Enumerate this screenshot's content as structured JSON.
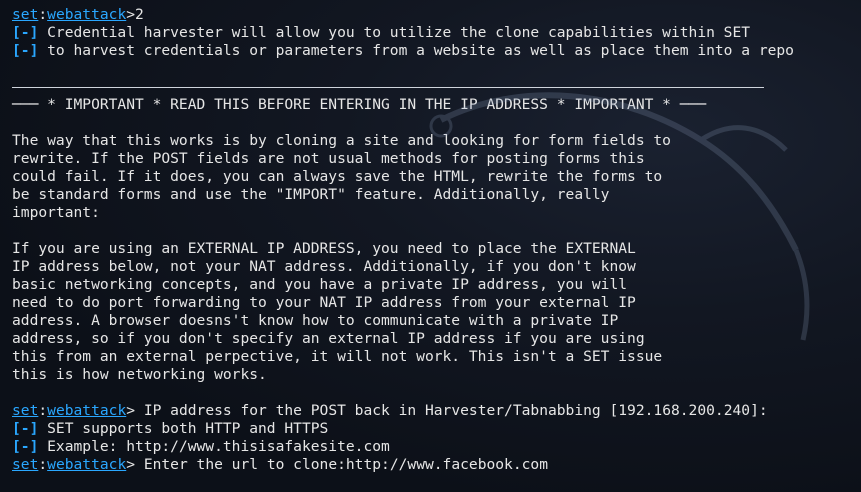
{
  "prompt": {
    "set": "set",
    "sep": ":",
    "module": "webattack",
    "gt": ">"
  },
  "lines": {
    "l1_input": "2",
    "info_tag": "[-]",
    "l2": " Credential harvester will allow you to utilize the clone capabilities within SET",
    "l3": " to harvest credentials or parameters from a website as well as place them into a repo",
    "banner": "─── * IMPORTANT * READ THIS BEFORE ENTERING IN THE IP ADDRESS * IMPORTANT * ───",
    "p1": [
      "The way that this works is by cloning a site and looking for form fields to",
      "rewrite. If the POST fields are not usual methods for posting forms this",
      "could fail. If it does, you can always save the HTML, rewrite the forms to",
      "be standard forms and use the \"IMPORT\" feature. Additionally, really",
      "important:"
    ],
    "p2": [
      "If you are using an EXTERNAL IP ADDRESS, you need to place the EXTERNAL",
      "IP address below, not your NAT address. Additionally, if you don't know",
      "basic networking concepts, and you have a private IP address, you will",
      "need to do port forwarding to your NAT IP address from your external IP",
      "address. A browser doesns't know how to communicate with a private IP",
      "address, so if you don't specify an external IP address if you are using",
      "this from an external perpective, it will not work. This isn't a SET issue",
      "this is how networking works."
    ],
    "ip_prompt": " IP address for the POST back in Harvester/Tabnabbing [192.168.200.240]:",
    "supports": " SET supports both HTTP and HTTPS",
    "example": " Example: http://www.thisisafakesite.com",
    "url_prompt": " Enter the url to clone:http://www.facebook.com"
  },
  "colors": {
    "accent": "#2aa7ff",
    "text": "#e6e6e6",
    "background": "#0d1117"
  }
}
